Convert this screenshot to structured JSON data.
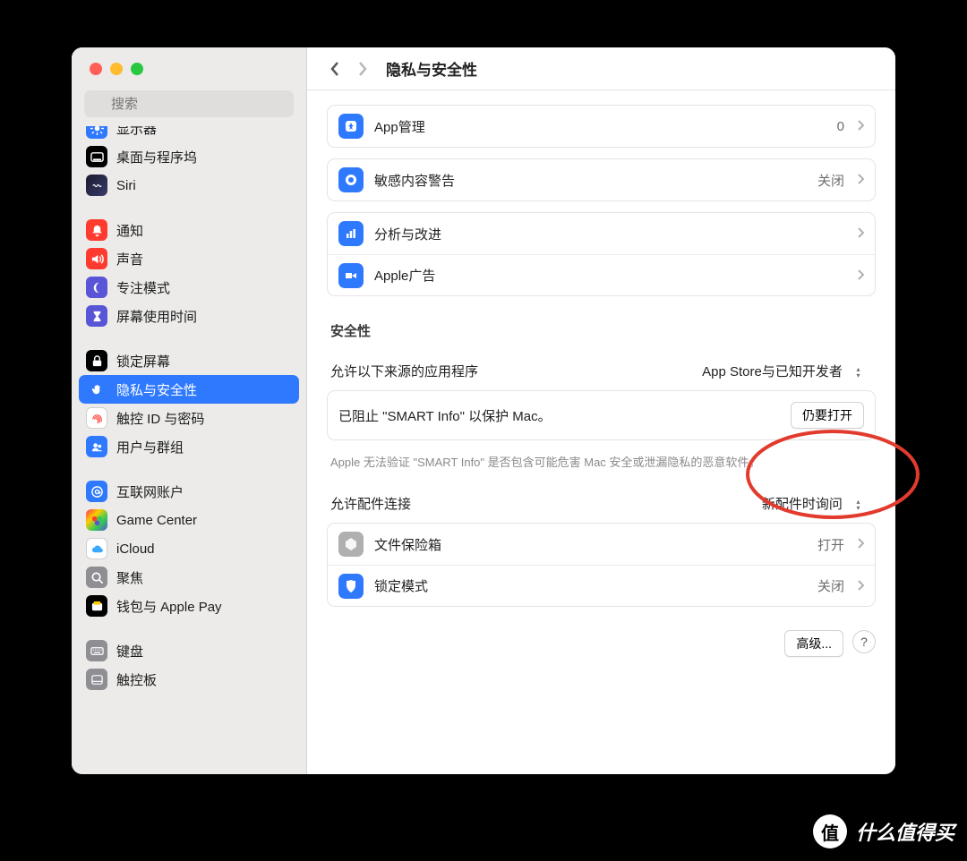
{
  "window": {
    "search_placeholder": "搜索",
    "page_title": "隐私与安全性"
  },
  "sidebar": {
    "items": [
      {
        "label": "显示器",
        "color": "#2f79ff",
        "icon": "sun",
        "selected": false,
        "cut": true
      },
      {
        "label": "桌面与程序坞",
        "color": "#000000",
        "icon": "dock",
        "selected": false
      },
      {
        "label": "Siri",
        "color": "gradient",
        "icon": "siri",
        "selected": false
      },
      {
        "spacer": true
      },
      {
        "label": "通知",
        "color": "#ff3b30",
        "icon": "bell",
        "selected": false
      },
      {
        "label": "声音",
        "color": "#ff3b30",
        "icon": "speaker",
        "selected": false
      },
      {
        "label": "专注模式",
        "color": "#5856d6",
        "icon": "moon",
        "selected": false
      },
      {
        "label": "屏幕使用时间",
        "color": "#5856d6",
        "icon": "hourglass",
        "selected": false
      },
      {
        "spacer": true
      },
      {
        "label": "锁定屏幕",
        "color": "#000000",
        "icon": "lock",
        "selected": false
      },
      {
        "label": "隐私与安全性",
        "color": "#2f79ff",
        "icon": "hand",
        "selected": true
      },
      {
        "label": "触控 ID 与密码",
        "color": "#ffffff",
        "icon": "fingerprint",
        "selected": false,
        "fg": "#ff3b30"
      },
      {
        "label": "用户与群组",
        "color": "#2f79ff",
        "icon": "users",
        "selected": false
      },
      {
        "spacer": true
      },
      {
        "label": "互联网账户",
        "color": "#2f79ff",
        "icon": "at",
        "selected": false
      },
      {
        "label": "Game Center",
        "color": "gradient2",
        "icon": "gc",
        "selected": false
      },
      {
        "label": "iCloud",
        "color": "#ffffff",
        "icon": "cloud",
        "selected": false,
        "fg": "#39aaff"
      },
      {
        "label": "聚焦",
        "color": "#8e8e93",
        "icon": "search",
        "selected": false
      },
      {
        "label": "钱包与 Apple Pay",
        "color": "#000000",
        "icon": "wallet",
        "selected": false
      },
      {
        "spacer": true
      },
      {
        "label": "键盘",
        "color": "#8e8e93",
        "icon": "keyboard",
        "selected": false
      },
      {
        "label": "触控板",
        "color": "#8e8e93",
        "icon": "trackpad",
        "selected": false,
        "cut": true
      }
    ]
  },
  "rows": {
    "app_mgmt": {
      "label": "App管理",
      "value": "0"
    },
    "sensitive": {
      "label": "敏感内容警告",
      "value": "关闭"
    },
    "analytics": {
      "label": "分析与改进"
    },
    "ads": {
      "label": "Apple广告"
    }
  },
  "security": {
    "heading": "安全性",
    "allow_sources": {
      "label": "允许以下来源的应用程序",
      "value": "App Store与已知开发者"
    },
    "blocked": {
      "text": "已阻止 \"SMART Info\" 以保护 Mac。",
      "button": "仍要打开"
    },
    "blocked_hint": "Apple 无法验证 \"SMART Info\" 是否包含可能危害 Mac 安全或泄漏隐私的恶意软件。",
    "accessories": {
      "label": "允许配件连接",
      "value": "新配件时询问"
    },
    "filevault": {
      "label": "文件保险箱",
      "value": "打开"
    },
    "lockdown": {
      "label": "锁定模式",
      "value": "关闭"
    },
    "advanced_btn": "高级..."
  },
  "watermark": {
    "text": "什么值得买",
    "badge": "值"
  }
}
